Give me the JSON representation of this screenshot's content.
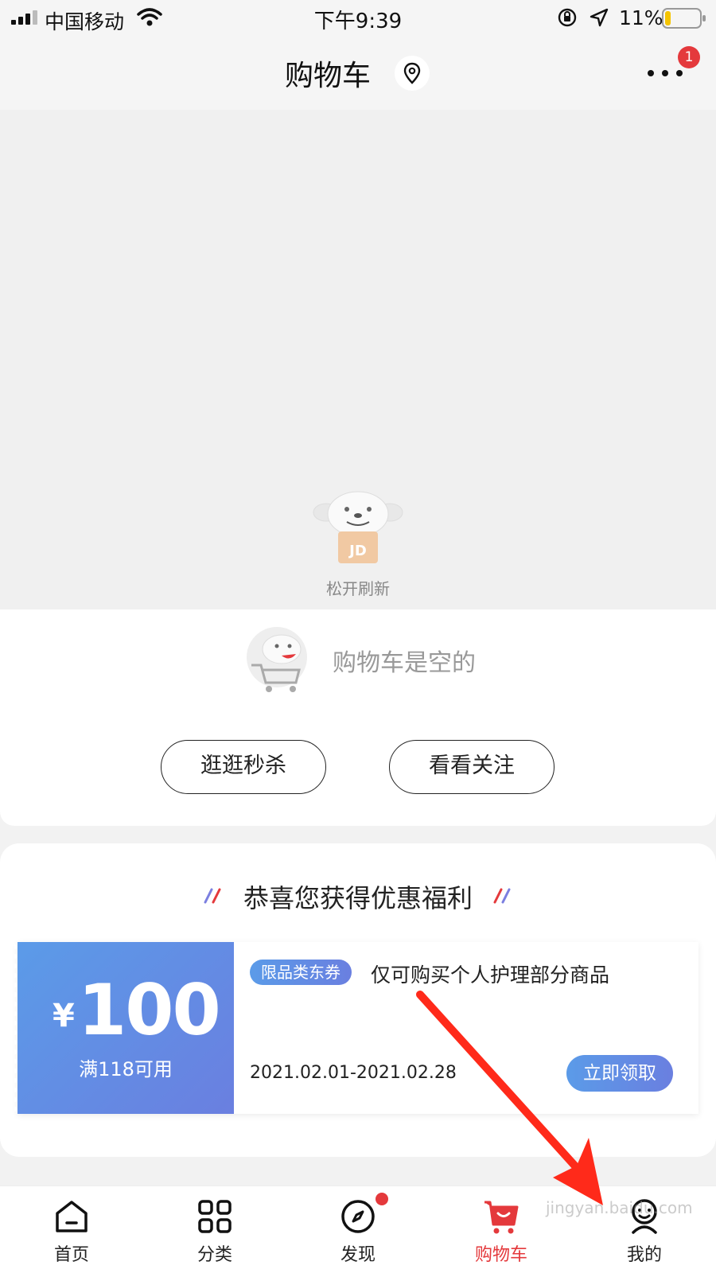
{
  "status_bar": {
    "carrier": "中国移动",
    "time": "下午9:39",
    "battery_percent": "11%"
  },
  "nav": {
    "title": "购物车",
    "more_badge": "1"
  },
  "refresh": {
    "hint": "松开刷新"
  },
  "empty_cart": {
    "message": "购物车是空的",
    "btn_seckill": "逛逛秒杀",
    "btn_follow": "看看关注"
  },
  "welfare": {
    "title": "恭喜您获得优惠福利",
    "coupon": {
      "currency": "¥",
      "amount": "100",
      "condition": "满118可用",
      "tag": "限品类东券",
      "scope": "仅可购买个人护理部分商品",
      "dates": "2021.02.01-2021.02.28",
      "claim_label": "立即领取"
    }
  },
  "tabs": [
    {
      "label": "首页",
      "icon": "home-icon"
    },
    {
      "label": "分类",
      "icon": "category-icon"
    },
    {
      "label": "发现",
      "icon": "compass-icon"
    },
    {
      "label": "购物车",
      "icon": "cart-icon",
      "active": true
    },
    {
      "label": "我的",
      "icon": "profile-icon"
    }
  ],
  "colors": {
    "accent_red": "#e4393c",
    "coupon_blue": "#5b9be8",
    "coupon_purple": "#6a7fe0"
  },
  "watermark": "jingyan.baidu.com"
}
